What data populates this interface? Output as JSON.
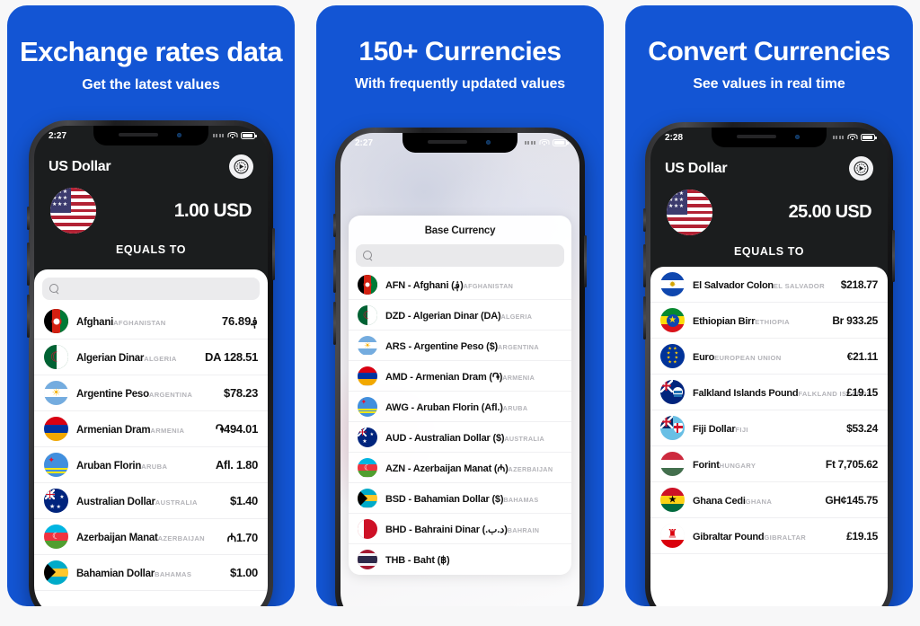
{
  "panels": [
    {
      "title": "Exchange rates data",
      "subtitle": "Get the latest values",
      "phone": {
        "status": {
          "time": "2:27",
          "wifi": "wifi-icon",
          "battery": "battery-icon"
        },
        "base_currency": "US Dollar",
        "settings_icon": "gear-icon",
        "amount": "1.00 USD",
        "equals_label": "EQUALS TO",
        "search_placeholder": "",
        "search_value": ""
      },
      "rows": [
        {
          "name": "Afghani",
          "country": "AFGHANISTAN",
          "value": "76.89؋"
        },
        {
          "name": "Algerian Dinar",
          "country": "ALGERIA",
          "value": "DA 128.51"
        },
        {
          "name": "Argentine Peso",
          "country": "ARGENTINA",
          "value": "$78.23"
        },
        {
          "name": "Armenian Dram",
          "country": "ARMENIA",
          "value": "֏494.01"
        },
        {
          "name": "Aruban Florin",
          "country": "ARUBA",
          "value": "Afl. 1.80"
        },
        {
          "name": "Australian Dollar",
          "country": "AUSTRALIA",
          "value": "$1.40"
        },
        {
          "name": "Azerbaijan Manat",
          "country": "AZERBAIJAN",
          "value": "₼1.70"
        },
        {
          "name": "Bahamian Dollar",
          "country": "BAHAMAS",
          "value": "$1.00"
        }
      ]
    },
    {
      "title": "150+ Currencies",
      "subtitle": "With frequently updated values",
      "phone": {
        "status": {
          "time": "2:27",
          "wifi": "wifi-icon",
          "battery": "battery-icon"
        },
        "modal_title": "Base Currency",
        "search_placeholder": "",
        "search_value": ""
      },
      "rows": [
        {
          "name": "AFN - Afghani (؋)",
          "country": "AFGHANISTAN"
        },
        {
          "name": "DZD - Algerian Dinar (DA)",
          "country": "ALGERIA"
        },
        {
          "name": "ARS - Argentine Peso ($)",
          "country": "ARGENTINA"
        },
        {
          "name": "AMD - Armenian Dram (֏)",
          "country": "ARMENIA"
        },
        {
          "name": "AWG - Aruban Florin (Afl.)",
          "country": "ARUBA"
        },
        {
          "name": "AUD - Australian Dollar ($)",
          "country": "AUSTRALIA"
        },
        {
          "name": "AZN - Azerbaijan Manat (₼)",
          "country": "AZERBAIJAN"
        },
        {
          "name": "BSD - Bahamian Dollar ($)",
          "country": "BAHAMAS"
        },
        {
          "name": "BHD - Bahraini Dinar (.د.ب)",
          "country": "BAHRAIN"
        },
        {
          "name": "THB - Baht (฿)",
          "country": ""
        }
      ]
    },
    {
      "title": "Convert Currencies",
      "subtitle": "See values in real time",
      "phone": {
        "status": {
          "time": "2:28",
          "wifi": "wifi-icon",
          "battery": "battery-icon"
        },
        "base_currency": "US Dollar",
        "settings_icon": "gear-icon",
        "amount": "25.00 USD",
        "equals_label": "EQUALS TO"
      },
      "rows": [
        {
          "name": "El Salvador Colon",
          "country": "EL SALVADOR",
          "value": "$218.77"
        },
        {
          "name": "Ethiopian Birr",
          "country": "ETHIOPIA",
          "value": "Br 933.25"
        },
        {
          "name": "Euro",
          "country": "EUROPEAN UNION",
          "value": "€21.11"
        },
        {
          "name": "Falkland Islands Pound",
          "country": "FALKLAND ISLANDS",
          "value": "£19.15"
        },
        {
          "name": "Fiji Dollar",
          "country": "FIJI",
          "value": "$53.24"
        },
        {
          "name": "Forint",
          "country": "HUNGARY",
          "value": "Ft 7,705.62"
        },
        {
          "name": "Ghana Cedi",
          "country": "GHANA",
          "value": "GH¢145.75"
        },
        {
          "name": "Gibraltar Pound",
          "country": "GIBRALTAR",
          "value": "£19.15"
        }
      ]
    }
  ],
  "colors": {
    "brand_blue": "#1355d4",
    "page_bg": "#f7f7f8",
    "screen_dark": "#1b1d1e",
    "sheet_white": "#ffffff"
  }
}
